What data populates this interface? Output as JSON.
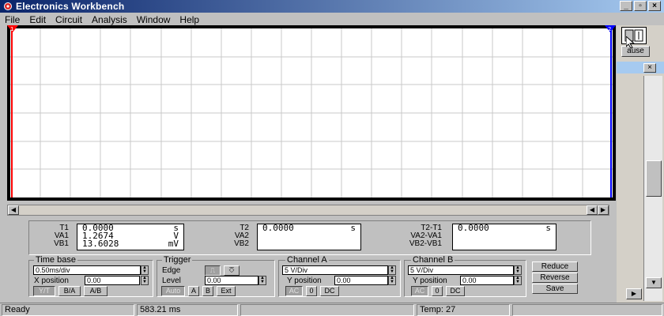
{
  "window": {
    "title": "Electronics Workbench"
  },
  "menu": [
    "File",
    "Edit",
    "Circuit",
    "Analysis",
    "Window",
    "Help"
  ],
  "readout": {
    "left": {
      "labels": [
        "T1",
        "VA1",
        "VB1"
      ],
      "values": [
        "0.0000",
        "1.2674",
        "13.6028"
      ],
      "units": [
        "s",
        "V",
        "mV"
      ]
    },
    "middle": {
      "labels": [
        "T2",
        "VA2",
        "VB2"
      ],
      "values": [
        "0.0000"
      ],
      "units": [
        "s"
      ]
    },
    "right": {
      "labels": [
        "T2-T1",
        "VA2-VA1",
        "VB2-VB1"
      ],
      "values": [
        "0.0000"
      ],
      "units": [
        "s"
      ]
    }
  },
  "timebase": {
    "title": "Time base",
    "scale": "0.50ms/div",
    "xpos_label": "X position",
    "xpos": "0.00",
    "buttons": [
      "Y/T",
      "B/A",
      "A/B"
    ]
  },
  "trigger": {
    "title": "Trigger",
    "edge_label": "Edge",
    "level_label": "Level",
    "level": "0.00",
    "buttons": [
      "Auto",
      "A",
      "B",
      "Ext"
    ]
  },
  "channel_a": {
    "title": "Channel A",
    "scale": "5 V/Div",
    "ypos_label": "Y position",
    "ypos": "0.00",
    "buttons": [
      "AC",
      "0",
      "DC"
    ]
  },
  "channel_b": {
    "title": "Channel B",
    "scale": "5 V/Div",
    "ypos_label": "Y position",
    "ypos": "0.00",
    "buttons": [
      "AC",
      "0",
      "DC"
    ]
  },
  "actions": [
    "Reduce",
    "Reverse",
    "Save"
  ],
  "right_pane": {
    "pause_text": "ause"
  },
  "status": [
    "Ready",
    "583.21 ms",
    "",
    "Temp:  27",
    ""
  ],
  "colors": {
    "title_start": "#0a246a",
    "title_end": "#a6caf0",
    "cursor1": "#ff0000",
    "cursor2": "#0000ff"
  }
}
